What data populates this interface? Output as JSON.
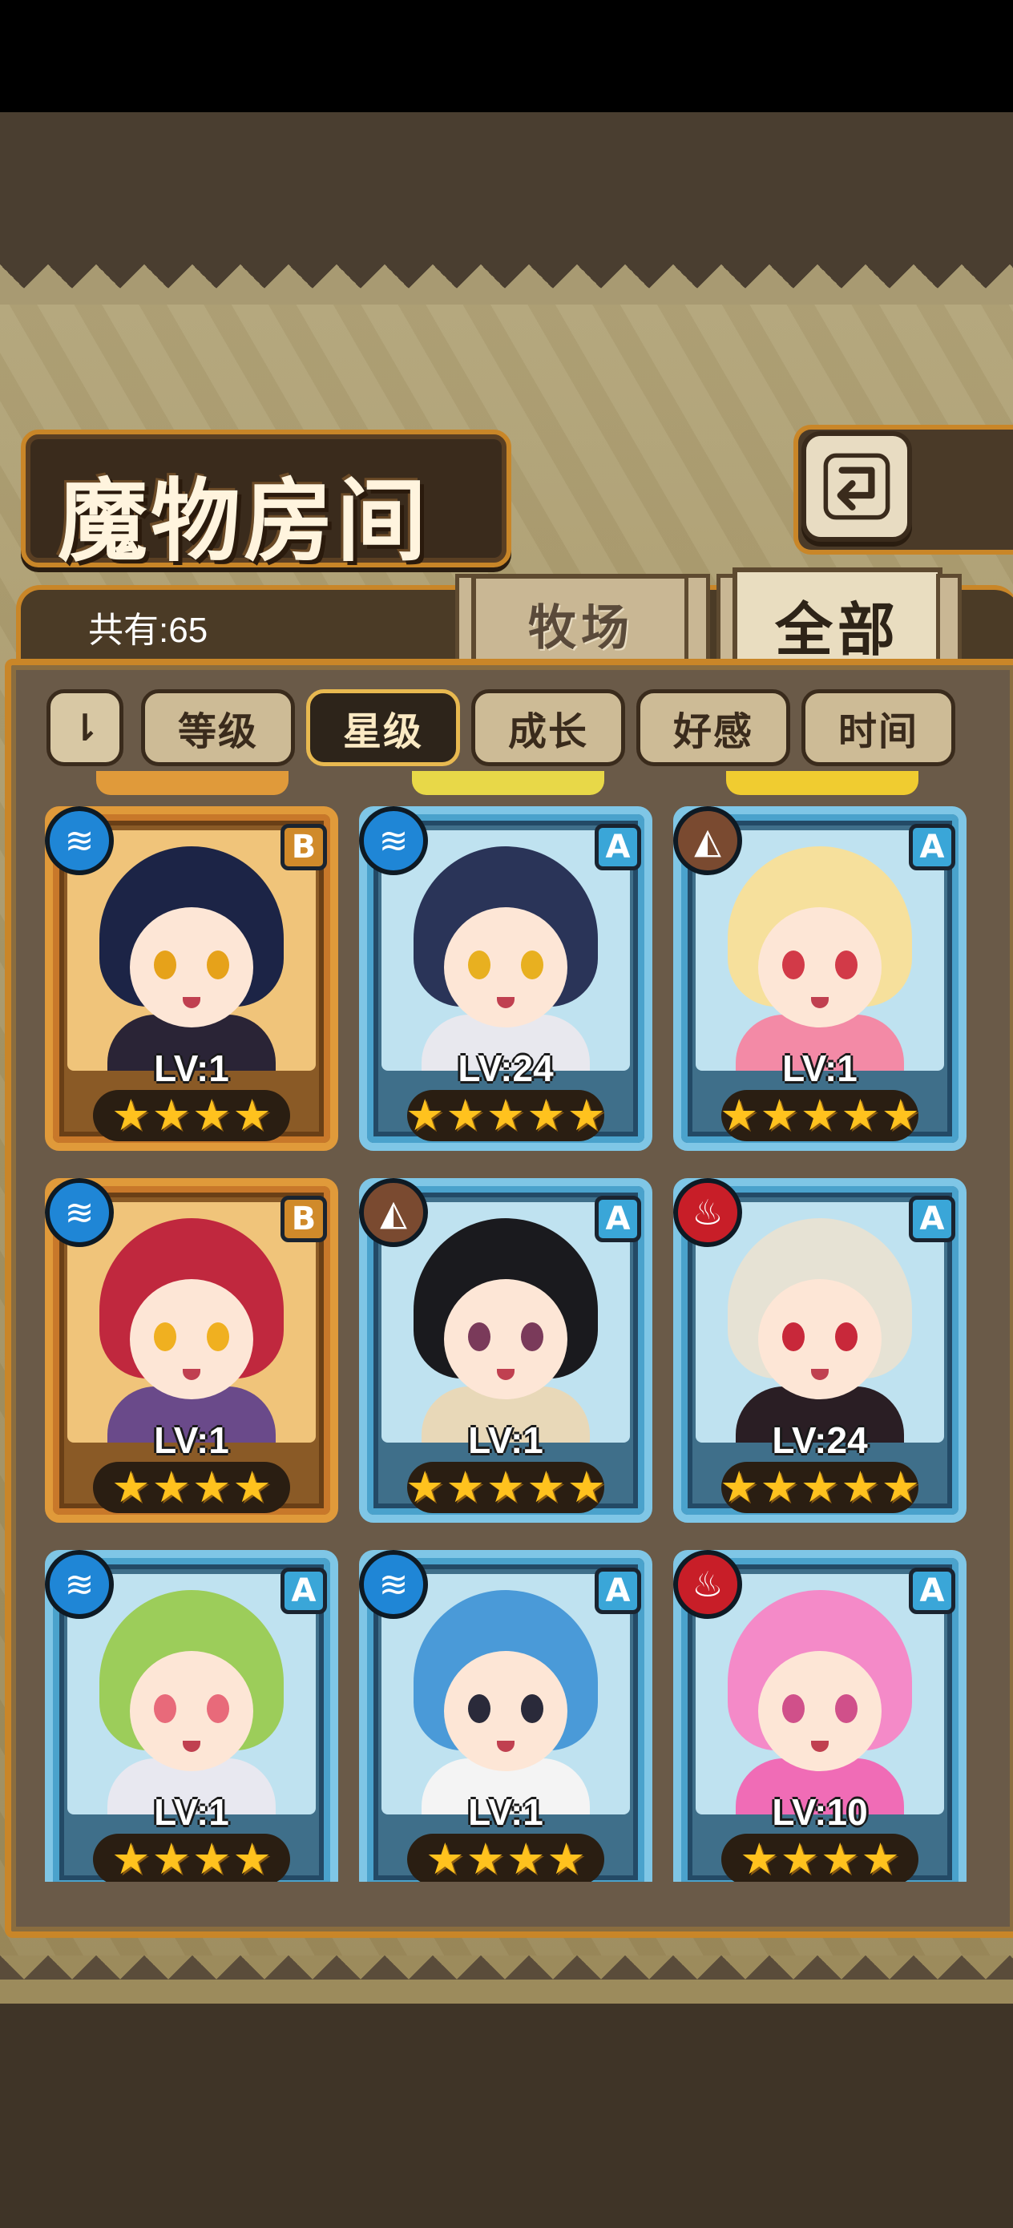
{
  "header": {
    "title": "魔物房间",
    "back_icon": "return-arrow-icon"
  },
  "summary": {
    "count_text": "共有:65"
  },
  "tabs": [
    {
      "label": "牧场",
      "selected": false
    },
    {
      "label": "全部",
      "selected": true
    }
  ],
  "sort": {
    "toggle_glyph": "⇂",
    "options": [
      {
        "label": "等级",
        "active": false
      },
      {
        "label": "星级",
        "active": true
      },
      {
        "label": "成长",
        "active": false
      },
      {
        "label": "好感",
        "active": false
      },
      {
        "label": "时间",
        "active": false
      }
    ]
  },
  "monsters": [
    {
      "level": "LV:1",
      "element": "water",
      "rank": "B",
      "stars": 4,
      "hair": "#1c2446",
      "eyes": "#e6a21a",
      "outfit": "#2a2436"
    },
    {
      "level": "LV:24",
      "element": "water",
      "rank": "A",
      "stars": 5,
      "hair": "#2a3458",
      "eyes": "#e8b020",
      "outfit": "#e8e8ee"
    },
    {
      "level": "LV:1",
      "element": "earth",
      "rank": "A",
      "stars": 5,
      "hair": "#f6e09c",
      "eyes": "#d23a48",
      "outfit": "#f38aa6"
    },
    {
      "level": "LV:1",
      "element": "water",
      "rank": "B",
      "stars": 4,
      "hair": "#c0283e",
      "eyes": "#f0b020",
      "outfit": "#6a4a8a"
    },
    {
      "level": "LV:1",
      "element": "earth",
      "rank": "A",
      "stars": 5,
      "hair": "#1a1a1e",
      "eyes": "#7a3a5a",
      "outfit": "#e8d8b8"
    },
    {
      "level": "LV:24",
      "element": "fire",
      "rank": "A",
      "stars": 5,
      "hair": "#e6e2d4",
      "eyes": "#c8283a",
      "outfit": "#2a1e24"
    },
    {
      "level": "LV:1",
      "element": "water",
      "rank": "A",
      "stars": 4,
      "hair": "#9ccd5a",
      "eyes": "#e86a7a",
      "outfit": "#e8e8f0"
    },
    {
      "level": "LV:1",
      "element": "water",
      "rank": "A",
      "stars": 4,
      "hair": "#4a9ad8",
      "eyes": "#2a2a3a",
      "outfit": "#f4f4f4"
    },
    {
      "level": "LV:10",
      "element": "fire",
      "rank": "A",
      "stars": 4,
      "hair": "#f48ac8",
      "eyes": "#d0508a",
      "outfit": "#f06cb6"
    }
  ],
  "colors": {
    "frame_gold": "#e09a3a",
    "frame_blue": "#7fc6e6",
    "star": "#ffc21e",
    "water": "#1f86d6",
    "earth": "#7a4a30",
    "fire": "#c81e28"
  },
  "icons": {
    "water": "water-wave-icon",
    "earth": "earth-mountain-icon",
    "fire": "fire-flame-icon"
  }
}
